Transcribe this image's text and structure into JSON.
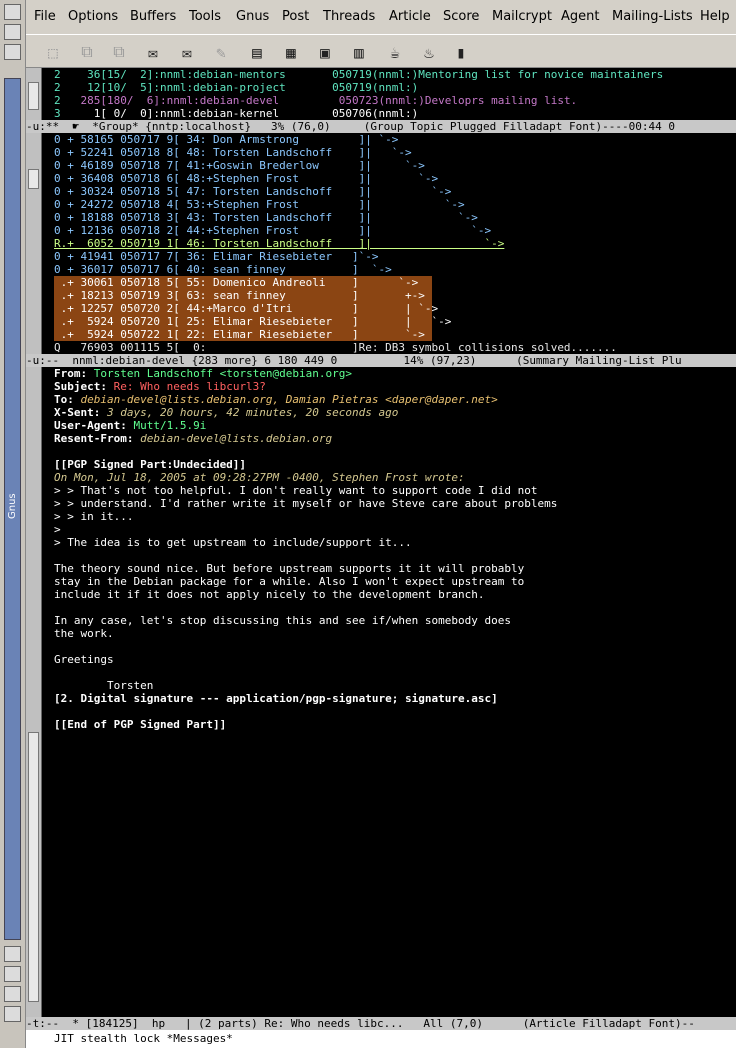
{
  "menu": [
    "File",
    "Options",
    "Buffers",
    "Tools",
    "Gnus",
    "Post",
    "Threads",
    "Article",
    "Score",
    "Mailcrypt",
    "Agent",
    "Mailing-Lists",
    "Help"
  ],
  "side_label": "Gnus",
  "group": {
    "lines": [
      {
        "mark": "2",
        "text": "    36[15/  2]:nnml:debian-mentors       050719(nnml:)Mentoring list for novice maintainers",
        "cls": "c-grp"
      },
      {
        "mark": "2",
        "text": "    12[10/  5]:nnml:debian-project       050719(nnml:)",
        "cls": "c-grp"
      },
      {
        "mark": "2",
        "text": "   285[180/  6]:nnml:debian-devel         050723(nnml:)Developrs mailing list.",
        "cls": "c-mag"
      },
      {
        "mark": "3",
        "text": "     1[ 0/  0]:nnml:debian-kernel        050706(nnml:)",
        "cls": "c-grpw"
      }
    ],
    "modeline": "-u:**  ☛  *Group* {nntp:localhost}   3% (76,0)     (Group Topic Plugged Filladapt Font)----00:44 0"
  },
  "summary": {
    "lines": [
      {
        "text": "0 + 58165 050717 9[ 34: Don Armstrong         ]| `->",
        "cls": "c-lb"
      },
      {
        "text": "0 + 52241 050718 8[ 48: Torsten Landschoff    ]|   `->",
        "cls": "c-lb"
      },
      {
        "text": "0 + 46189 050718 7[ 41:+Goswin Brederlow      ]|     `->",
        "cls": "c-lb"
      },
      {
        "text": "0 + 36408 050718 6[ 48:+Stephen Frost         ]|       `->",
        "cls": "c-lb"
      },
      {
        "text": "0 + 30324 050718 5[ 47: Torsten Landschoff    ]|         `->",
        "cls": "c-lb"
      },
      {
        "text": "0 + 24272 050718 4[ 53:+Stephen Frost         ]|           `->",
        "cls": "c-lb"
      },
      {
        "text": "0 + 18188 050718 3[ 43: Torsten Landschoff    ]|             `->",
        "cls": "c-lb"
      },
      {
        "text": "0 + 12136 050718 2[ 44:+Stephen Frost         ]|               `->",
        "cls": "c-lb"
      },
      {
        "text": "R.+  6052 050719 1[ 46: Torsten Landschoff    ]|                 `->",
        "cls": "c-cur"
      },
      {
        "text": "0 + 41941 050717 7[ 36: Elimar Riesebieter   ]`->",
        "cls": "c-lb"
      },
      {
        "text": "0 + 36017 050717 6[ 40: sean finney          ]  `->",
        "cls": "c-lb"
      },
      {
        "text": " .+ 30061 050718 5[ 55: Domenico Andreoli    ]      `->",
        "cls": "c-sel"
      },
      {
        "text": " .+ 18213 050719 3[ 63: sean finney          ]       +->",
        "cls": "c-sel"
      },
      {
        "text": " .+ 12257 050720 2[ 44:+Marco d'Itri         ]       | `->",
        "cls": "c-sel"
      },
      {
        "text": " .+  5924 050720 1[ 25: Elimar Riesebieter   ]       |   `->",
        "cls": "c-sel"
      },
      {
        "text": " .+  5924 050722 1[ 22: Elimar Riesebieter   ]       `->",
        "cls": "c-sel"
      },
      {
        "text": "Q   76903 001115 5[  0:                      ]Re: DB3 symbol collisions solved.......",
        "cls": "c-wt"
      }
    ],
    "modeline": "-u:--  nnml:debian-devel {283 more} 6 180 449 0          14% (97,23)      (Summary Mailing-List Plu"
  },
  "article": {
    "headers": [
      {
        "k": "From:",
        "v": "Torsten Landschoff <torsten@debian.org>",
        "cls": "hv-green"
      },
      {
        "k": "Subject:",
        "v": "Re: Who needs libcurl3?",
        "cls": "hv-red"
      },
      {
        "k": "To:",
        "v": "debian-devel@lists.debian.org, Damian Pietras <daper@daper.net>",
        "cls": "hv-org"
      },
      {
        "k": "X-Sent:",
        "v": "3 days, 20 hours, 42 minutes, 20 seconds ago",
        "cls": "hv-it"
      },
      {
        "k": "User-Agent:",
        "v": "Mutt/1.5.9i",
        "cls": "hv-green"
      },
      {
        "k": "Resent-From:",
        "v": "debian-devel@lists.debian.org",
        "cls": "hv-it"
      }
    ],
    "body": [
      {
        "t": "",
        "c": "body"
      },
      {
        "t": "[[PGP Signed Part:Undecided]]",
        "c": "hdr"
      },
      {
        "t": "On Mon, Jul 18, 2005 at 09:28:27PM -0400, Stephen Frost wrote:",
        "c": "hv-it"
      },
      {
        "t": "> > That's not too helpful. I don't really want to support code I did not",
        "c": "q1"
      },
      {
        "t": "> > understand. I'd rather write it myself or have Steve care about problems",
        "c": "q1"
      },
      {
        "t": "> > in it...",
        "c": "q1"
      },
      {
        "t": ">",
        "c": "q1"
      },
      {
        "t": "> The idea is to get upstream to include/support it...",
        "c": "q1"
      },
      {
        "t": "",
        "c": "body"
      },
      {
        "t": "The theory sound nice. But before upstream supports it it will probably",
        "c": "body"
      },
      {
        "t": "stay in the Debian package for a while. Also I won't expect upstream to",
        "c": "body"
      },
      {
        "t": "include it if it does not apply nicely to the development branch.",
        "c": "body"
      },
      {
        "t": "",
        "c": "body"
      },
      {
        "t": "In any case, let's stop discussing this and see if/when somebody does",
        "c": "body"
      },
      {
        "t": "the work.",
        "c": "body"
      },
      {
        "t": "",
        "c": "body"
      },
      {
        "t": "Greetings",
        "c": "body"
      },
      {
        "t": "",
        "c": "body"
      },
      {
        "t": "        Torsten",
        "c": "body"
      },
      {
        "t": "[2. Digital signature --- application/pgp-signature; signature.asc]",
        "c": "hdr"
      },
      {
        "t": "",
        "c": "body"
      },
      {
        "t": "[[End of PGP Signed Part]]",
        "c": "hdr"
      }
    ],
    "modeline": "-t:--  * [184125]  hp   | (2 parts) Re: Who needs libc...   All (7,0)      (Article Filladapt Font)--"
  },
  "echo": "JIT stealth lock *Messages*"
}
